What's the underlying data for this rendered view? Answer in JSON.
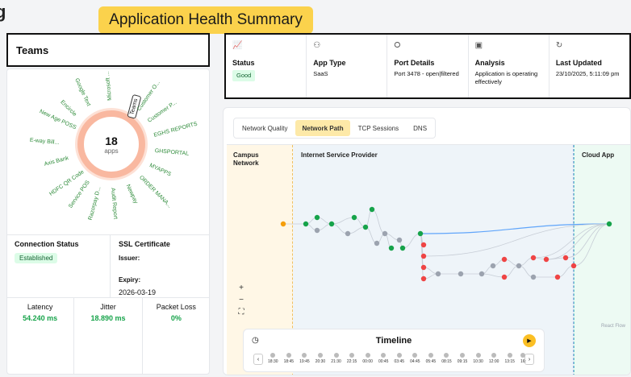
{
  "banner": {
    "title": "Application Health Summary"
  },
  "teams_panel": {
    "title": "Teams",
    "app_count": "18",
    "app_unit": "apps"
  },
  "apps": [
    "Microsoft ...",
    "Teams",
    "Customer O...",
    "Customer P...",
    "EGHS REPORTS",
    "GHSPORTAL",
    "MYAPPS",
    "ORDER MANA...",
    "Newpay",
    "Audit Report",
    "Razorpay D...",
    "Service POS",
    "HDFC QR Code",
    "Axis Bank",
    "E-way Bill...",
    "New Age POSS",
    "Encircle",
    "Google Text"
  ],
  "connection": {
    "label": "Connection Status",
    "value": "Established"
  },
  "ssl": {
    "label": "SSL Certificate",
    "issuer_label": "Issuer:",
    "expiry_label": "Expiry:",
    "expiry_value": "2026-03-19"
  },
  "metrics": [
    {
      "label": "Latency",
      "value": "54.240 ms"
    },
    {
      "label": "Jitter",
      "value": "18.890 ms"
    },
    {
      "label": "Packet Loss",
      "value": "0%"
    }
  ],
  "cards": [
    {
      "icon": "chart-icon",
      "title": "Status",
      "value": "Good"
    },
    {
      "icon": "people-icon",
      "title": "App Type",
      "value": "SaaS"
    },
    {
      "icon": "port-icon",
      "title": "Port Details",
      "value": "Port 3478 - open|filtered"
    },
    {
      "icon": "analysis-icon",
      "title": "Analysis",
      "value": "Application is operating effectively"
    },
    {
      "icon": "refresh-icon",
      "title": "Last Updated",
      "value": "23/10/2025, 5:11:09 pm"
    }
  ],
  "tabs": [
    "Network Quality",
    "Network Path",
    "TCP Sessions",
    "DNS"
  ],
  "active_tab": "Network Path",
  "zones": {
    "campus": "Campus Network",
    "isp": "Internet Service Provider",
    "cloud": "Cloud App"
  },
  "watermark": "React Flow",
  "timeline": {
    "title": "Timeline",
    "times": [
      "18:30",
      "18:45",
      "19:45",
      "20:30",
      "21:30",
      "22:15",
      "00:00",
      "00:45",
      "03:45",
      "04:45",
      "05:45",
      "08:15",
      "09:15",
      "10:30",
      "12:00",
      "13:15",
      "16:"
    ]
  },
  "colors": {
    "accent": "#fbd24c",
    "good": "#16a34a",
    "node_green": "#16a34a",
    "node_red": "#ef4444",
    "node_grey": "#9ca3af"
  }
}
